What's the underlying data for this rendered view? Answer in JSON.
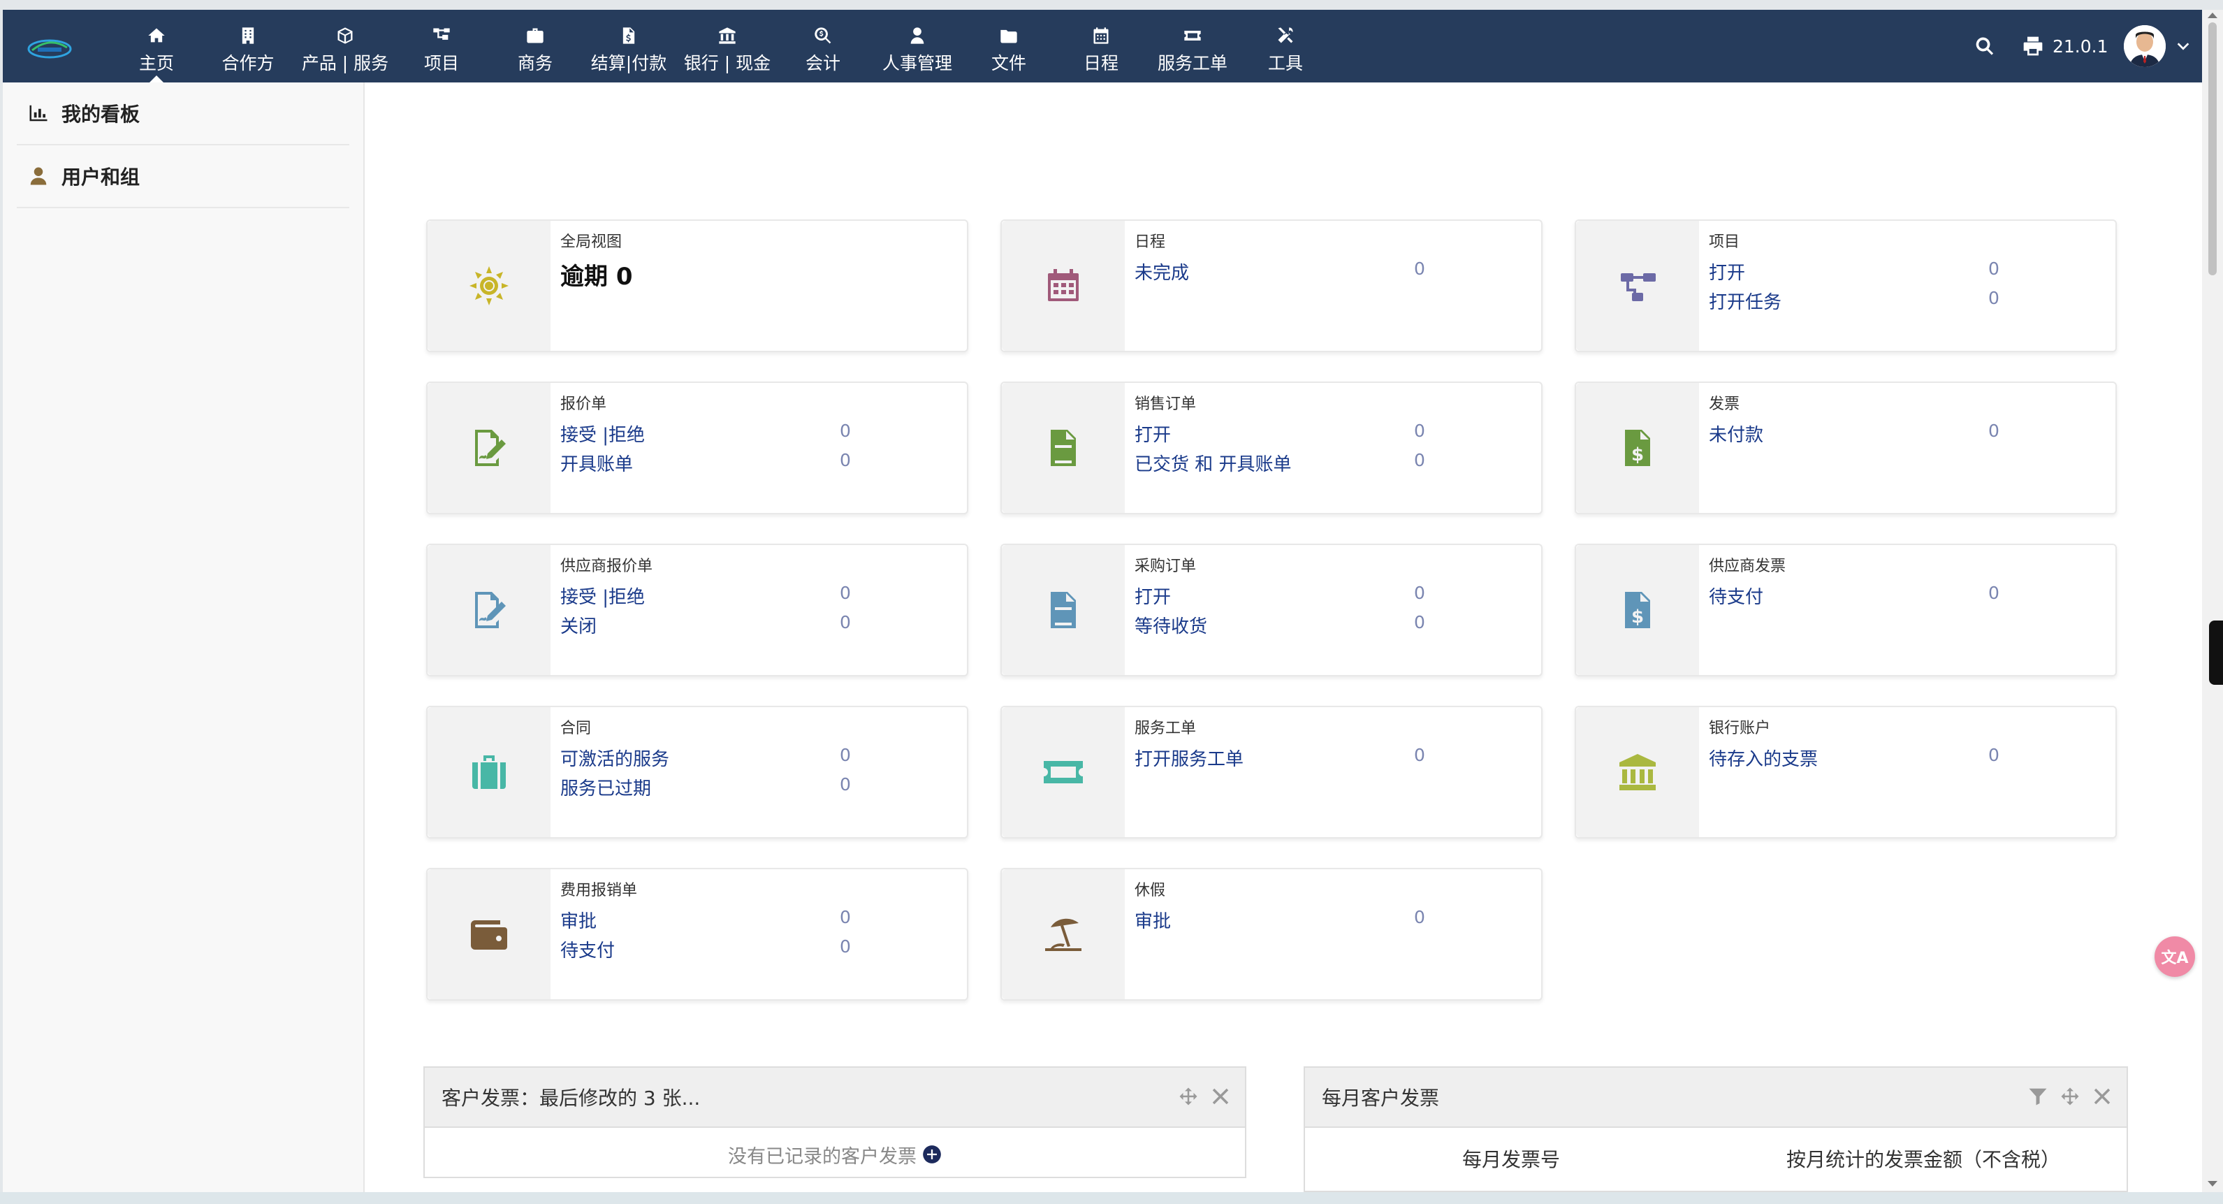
{
  "version": "21.0.1",
  "nav": [
    {
      "label": "主页",
      "icon": "home-icon"
    },
    {
      "label": "合作方",
      "icon": "building-icon"
    },
    {
      "label": "产品 | 服务",
      "icon": "cube-icon"
    },
    {
      "label": "项目",
      "icon": "project-icon"
    },
    {
      "label": "商务",
      "icon": "briefcase-icon"
    },
    {
      "label": "结算|付款",
      "icon": "invoice-icon"
    },
    {
      "label": "银行 | 现金",
      "icon": "bank-icon"
    },
    {
      "label": "会计",
      "icon": "search-dollar-icon"
    },
    {
      "label": "人事管理",
      "icon": "user-tie-icon"
    },
    {
      "label": "文件",
      "icon": "folder-icon"
    },
    {
      "label": "日程",
      "icon": "calendar-icon"
    },
    {
      "label": "服务工单",
      "icon": "ticket-icon"
    },
    {
      "label": "工具",
      "icon": "tools-icon"
    }
  ],
  "sidebar": [
    {
      "label": "我的看板",
      "icon": "chart-bar-icon"
    },
    {
      "label": "用户和组",
      "icon": "user-icon"
    }
  ],
  "cards": {
    "overview": {
      "title": "全局视图",
      "big": "逾期 0"
    },
    "agenda": {
      "title": "日程",
      "rows": [
        {
          "label": "未完成",
          "value": "0"
        }
      ]
    },
    "project": {
      "title": "项目",
      "rows": [
        {
          "label": "打开",
          "value": "0"
        },
        {
          "label": "打开任务",
          "value": "0"
        }
      ]
    },
    "propal": {
      "title": "报价单",
      "rows": [
        {
          "label": "接受 |拒绝",
          "value": "0"
        },
        {
          "label": "开具账单",
          "value": "0"
        }
      ]
    },
    "order": {
      "title": "销售订单",
      "rows": [
        {
          "label": "打开",
          "value": "0"
        },
        {
          "label": "已交货 和 开具账单",
          "value": "0"
        }
      ]
    },
    "invoice": {
      "title": "发票",
      "rows": [
        {
          "label": "未付款",
          "value": "0"
        }
      ]
    },
    "supplier_propal": {
      "title": "供应商报价单",
      "rows": [
        {
          "label": "接受 |拒绝",
          "value": "0"
        },
        {
          "label": "关闭",
          "value": "0"
        }
      ]
    },
    "supplier_order": {
      "title": "采购订单",
      "rows": [
        {
          "label": "打开",
          "value": "0"
        },
        {
          "label": "等待收货",
          "value": "0"
        }
      ]
    },
    "supplier_invoice": {
      "title": "供应商发票",
      "rows": [
        {
          "label": "待支付",
          "value": "0"
        }
      ]
    },
    "contract": {
      "title": "合同",
      "rows": [
        {
          "label": "可激活的服务",
          "value": "0"
        },
        {
          "label": "服务已过期",
          "value": "0"
        }
      ]
    },
    "ticket": {
      "title": "服务工单",
      "rows": [
        {
          "label": "打开服务工单",
          "value": "0"
        }
      ]
    },
    "bank": {
      "title": "银行账户",
      "rows": [
        {
          "label": "待存入的支票",
          "value": "0"
        }
      ]
    },
    "expense": {
      "title": "费用报销单",
      "rows": [
        {
          "label": "审批",
          "value": "0"
        },
        {
          "label": "待支付",
          "value": "0"
        }
      ]
    },
    "holiday": {
      "title": "休假",
      "rows": [
        {
          "label": "审批",
          "value": "0"
        }
      ]
    }
  },
  "widgets": {
    "customer_invoices": {
      "title": "客户发票：最后修改的 3 张...",
      "empty": "没有已记录的客户发票"
    },
    "monthly": {
      "title": "每月客户发票",
      "col1": "每月发票号",
      "col2": "按月统计的发票金额（不含税）"
    }
  },
  "translate": "文A",
  "colors": {
    "topbar": "#263c5c",
    "link": "#1a3a8a",
    "number": "#7a85b0"
  }
}
